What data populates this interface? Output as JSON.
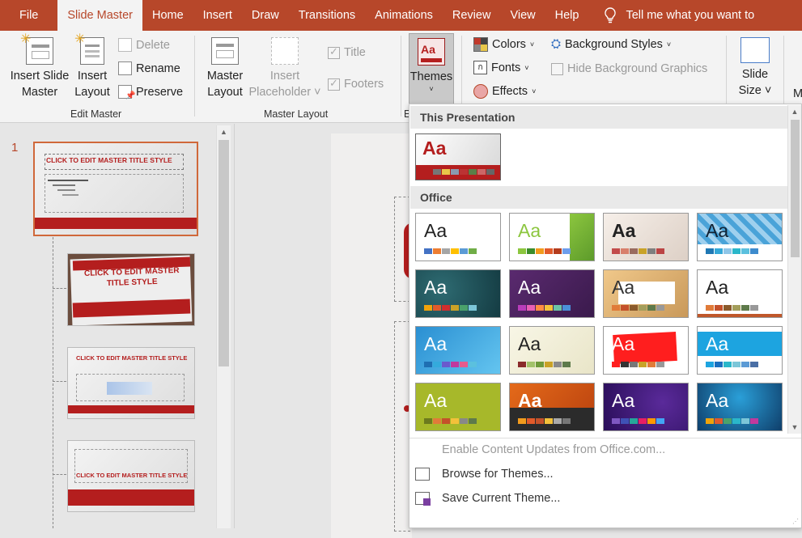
{
  "tabs": [
    {
      "label": "File"
    },
    {
      "label": "Slide Master"
    },
    {
      "label": "Home"
    },
    {
      "label": "Insert"
    },
    {
      "label": "Draw"
    },
    {
      "label": "Transitions"
    },
    {
      "label": "Animations"
    },
    {
      "label": "Review"
    },
    {
      "label": "View"
    },
    {
      "label": "Help"
    }
  ],
  "tell_me": "Tell me what you want to",
  "ribbon": {
    "edit_master": {
      "insert_slide_master_l1": "Insert Slide",
      "insert_slide_master_l2": "Master",
      "insert_layout_l1": "Insert",
      "insert_layout_l2": "Layout",
      "delete": "Delete",
      "rename": "Rename",
      "preserve": "Preserve",
      "label": "Edit Master"
    },
    "master_layout": {
      "master_layout_l1": "Master",
      "master_layout_l2": "Layout",
      "insert_placeholder_l1": "Insert",
      "insert_placeholder_l2": "Placeholder",
      "title": "Title",
      "footers": "Footers",
      "label": "Master Layout"
    },
    "edit_theme": {
      "themes": "Themes",
      "label": "E"
    },
    "background": {
      "colors": "Colors",
      "fonts": "Fonts",
      "effects": "Effects",
      "background_styles": "Background Styles",
      "hide_background_graphics": "Hide Background Graphics"
    },
    "size": {
      "slide_size_l1": "Slide",
      "slide_size_l2": "Size",
      "cut": "M"
    }
  },
  "slides_pane": {
    "slide_number": "1",
    "master_title": "CLICK TO EDIT MASTER TITLE STYLE",
    "layout2_title": "CLICK TO EDIT MASTER TITLE STYLE",
    "layout3_title": "CLICK TO EDIT MASTER TITLE STYLE",
    "layout4_title": "CLICK TO EDIT MASTER TITLE STYLE"
  },
  "gallery": {
    "section_this": "This Presentation",
    "section_office": "Office",
    "aa": "Aa",
    "enable_updates": "Enable Content Updates from Office.com...",
    "browse": "Browse for Themes...",
    "save": "Save Current Theme..."
  },
  "colors": {
    "accent": "#b7472a",
    "tab_active_text": "#b7472a"
  }
}
